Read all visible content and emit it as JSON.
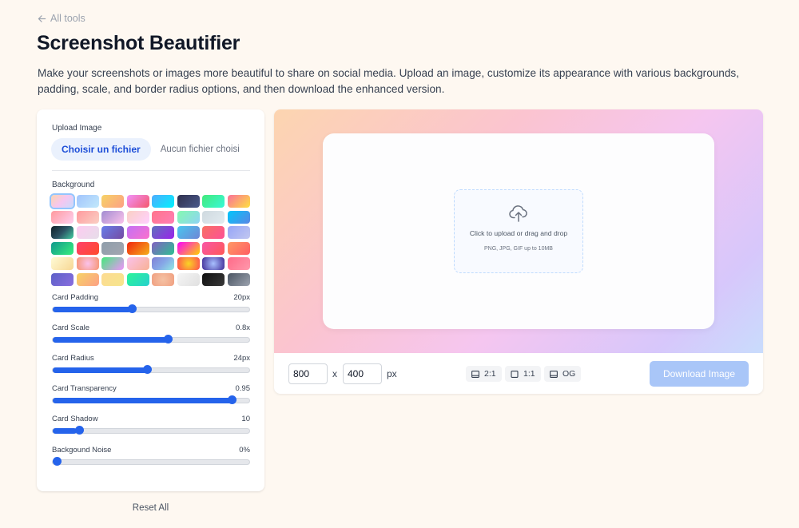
{
  "nav": {
    "back_label": "All tools"
  },
  "header": {
    "title": "Screenshot Beautifier",
    "description": "Make your screenshots or images more beautiful to share on social media. Upload an image, customize its appearance with various backgrounds, padding, scale, and border radius options, and then download the enhanced version."
  },
  "controls": {
    "upload_label": "Upload Image",
    "file_button": "Choisir un fichier",
    "file_status": "Aucun fichier choisi",
    "background_label": "Background",
    "selected_background": 0,
    "backgrounds": [
      "linear-gradient(135deg,#fcd5b0,#f5c6f0,#c9dcfc)",
      "linear-gradient(135deg,#a1c4fd,#c2e9fb)",
      "linear-gradient(135deg,#f6d365,#fda085)",
      "linear-gradient(135deg,#f093fb,#f5576c)",
      "linear-gradient(135deg,#4facfe,#00f2fe)",
      "linear-gradient(135deg,#30304e,#4a5a8c)",
      "linear-gradient(135deg,#43e97b,#38f9d7)",
      "linear-gradient(135deg,#fa709a,#fee140)",
      "linear-gradient(135deg,#ff9a9e,#fecfef)",
      "linear-gradient(135deg,#ff9a9e,#fad0c4)",
      "linear-gradient(135deg,#a18cd1,#fbc2eb)",
      "linear-gradient(135deg,#fad0c4,#ffd1ff)",
      "linear-gradient(135deg,#ff758c,#ff7eb3)",
      "linear-gradient(135deg,#84fab0,#8fd3f4)",
      "linear-gradient(135deg,#cfd9df,#e2ebf0)",
      "linear-gradient(135deg,#00c6fb,#5b86e5)",
      "linear-gradient(135deg,#0f2027,#2c5364,#43cea2)",
      "linear-gradient(135deg,#fdcbf1,#e6dee9)",
      "linear-gradient(135deg,#667eea,#764ba2)",
      "linear-gradient(135deg,#c471f5,#fa71cd)",
      "linear-gradient(135deg,#5f72bd,#9b23ea)",
      "linear-gradient(135deg,#48c6ef,#6f86d6)",
      "linear-gradient(135deg,#f77062,#fe5196)",
      "linear-gradient(135deg,#96a5f8,#c2c7f0)",
      "linear-gradient(135deg,#11998e,#38ef7d)",
      "linear-gradient(135deg,#ff416c,#ff4b2b)",
      "linear-gradient(135deg,#8e9eab,#a3a6b0)",
      "linear-gradient(135deg,#f12711,#f5af19)",
      "linear-gradient(135deg,#8360c3,#2ebf91)",
      "linear-gradient(135deg,#fc00ff,#ffd200)",
      "linear-gradient(135deg,#f857a6,#ff5858)",
      "linear-gradient(135deg,#ff9966,#ff5e62)",
      "linear-gradient(135deg,#fffbd5,#f7d794)",
      "radial-gradient(circle,#fbc2eb,#f6946f)",
      "linear-gradient(135deg,#43e97b,#f093fb)",
      "linear-gradient(135deg,#fbc2eb,#f8b195)",
      "linear-gradient(135deg,#7f7fd5,#86a8e7,#91eae4)",
      "radial-gradient(circle,#f9d423,#ff4e50)",
      "radial-gradient(circle,#a8c0ff,#3f2b96)",
      "linear-gradient(135deg,#ff6a88,#ff99ac)",
      "linear-gradient(135deg,#5b5fc7,#8a6fdf)",
      "linear-gradient(135deg,#f6d365,#fda085)",
      "linear-gradient(135deg,#fddb92,#f6e58d)",
      "linear-gradient(135deg,#2af598,#26d0ce)",
      "radial-gradient(circle,#f5c2a4,#f09f80)",
      "linear-gradient(135deg,#f5f5f5,#e0e0e0)",
      "linear-gradient(135deg,#0f0f0f,#3a3a3a)",
      "linear-gradient(135deg,#4b5563,#9ca3af)"
    ],
    "sliders": [
      {
        "key": "padding",
        "label": "Card Padding",
        "value_text": "20px",
        "fraction": 0.4
      },
      {
        "key": "scale",
        "label": "Card Scale",
        "value_text": "0.8x",
        "fraction": 0.59
      },
      {
        "key": "radius",
        "label": "Card Radius",
        "value_text": "24px",
        "fraction": 0.48
      },
      {
        "key": "transparency",
        "label": "Card Transparency",
        "value_text": "0.95",
        "fraction": 0.93
      },
      {
        "key": "shadow",
        "label": "Card Shadow",
        "value_text": "10",
        "fraction": 0.12
      },
      {
        "key": "noise",
        "label": "Backgound Noise",
        "value_text": "0%",
        "fraction": 0.0
      }
    ],
    "reset_label": "Reset All"
  },
  "preview": {
    "dropzone_main": "Click to upload or drag and drop",
    "dropzone_sub": "PNG, JPG, GIF up to 10MB",
    "width_value": "800",
    "height_value": "400",
    "x_label": "x",
    "unit_label": "px",
    "presets": [
      {
        "label": "2:1",
        "icon": "landscape-icon"
      },
      {
        "label": "1:1",
        "icon": "square-icon"
      },
      {
        "label": "OG",
        "icon": "og-card-icon"
      }
    ],
    "download_label": "Download Image"
  },
  "colors": {
    "accent": "#2563eb",
    "page_bg": "#fef8f1",
    "download_disabled": "#a9c6f8"
  }
}
